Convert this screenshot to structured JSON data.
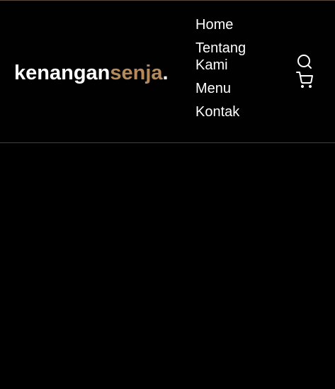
{
  "brand": {
    "part_a": "kenangan",
    "part_b": "senja",
    "part_c": ".",
    "accent_color": "#b6895b"
  },
  "nav": {
    "items": [
      {
        "label": "Home"
      },
      {
        "label": "Tentang Kami"
      },
      {
        "label": "Menu"
      },
      {
        "label": "Kontak"
      }
    ]
  },
  "icons": {
    "search": "search-icon",
    "cart": "shopping-cart-icon"
  },
  "colors": {
    "background": "#010101",
    "text": "#ffffff",
    "divider": "#4a3d33"
  }
}
